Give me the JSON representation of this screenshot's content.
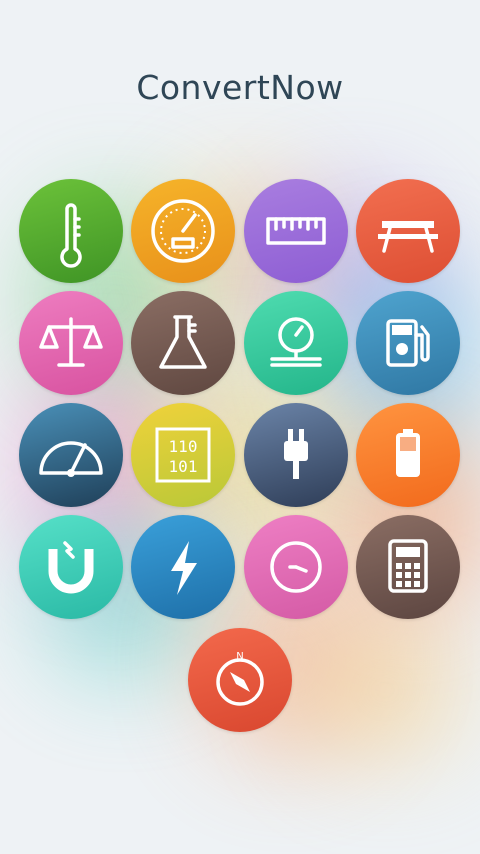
{
  "app": {
    "title": "ConvertNow"
  },
  "tiles": [
    {
      "name": "temperature",
      "icon": "thermometer-icon",
      "c1": "#6cc23a",
      "c2": "#3f9425"
    },
    {
      "name": "speed",
      "icon": "speedometer-icon",
      "c1": "#f6b42a",
      "c2": "#e8901a"
    },
    {
      "name": "length",
      "icon": "ruler-icon",
      "c1": "#a97ee0",
      "c2": "#8d5dd3"
    },
    {
      "name": "area",
      "icon": "picnic-table-icon",
      "c1": "#f26f50",
      "c2": "#dd4e33"
    },
    {
      "name": "weight",
      "icon": "scales-icon",
      "c1": "#ee7dc0",
      "c2": "#d852a0"
    },
    {
      "name": "volume",
      "icon": "flask-icon",
      "c1": "#8b6e64",
      "c2": "#5f4740"
    },
    {
      "name": "pressure",
      "icon": "gauge-icon",
      "c1": "#4fdcb0",
      "c2": "#23b58a"
    },
    {
      "name": "fuel-consumption",
      "icon": "fuel-pump-icon",
      "c1": "#4fa4cf",
      "c2": "#2f77a3"
    },
    {
      "name": "angle",
      "icon": "protractor-icon",
      "c1": "#4a90b8",
      "c2": "#1f3f58"
    },
    {
      "name": "digital-storage",
      "icon": "binary-icon",
      "c1": "#f0d23a",
      "c2": "#b9c838",
      "binary_top": "110",
      "binary_bottom": "101"
    },
    {
      "name": "power",
      "icon": "plug-icon",
      "c1": "#6b84a8",
      "c2": "#2e3d57"
    },
    {
      "name": "energy",
      "icon": "battery-icon",
      "c1": "#ff9440",
      "c2": "#f26a1c"
    },
    {
      "name": "magnetism",
      "icon": "magnet-icon",
      "c1": "#56e0c8",
      "c2": "#2ab9a5"
    },
    {
      "name": "electricity",
      "icon": "lightning-icon",
      "c1": "#3aa0da",
      "c2": "#1e6fa8"
    },
    {
      "name": "time",
      "icon": "clock-icon",
      "c1": "#ee7fc4",
      "c2": "#d45aa5"
    },
    {
      "name": "calculator",
      "icon": "calculator-icon",
      "c1": "#8b6e64",
      "c2": "#5c4540"
    },
    {
      "name": "direction",
      "icon": "compass-icon",
      "c1": "#f3694c",
      "c2": "#d9472f",
      "compass_letter": "N"
    }
  ]
}
